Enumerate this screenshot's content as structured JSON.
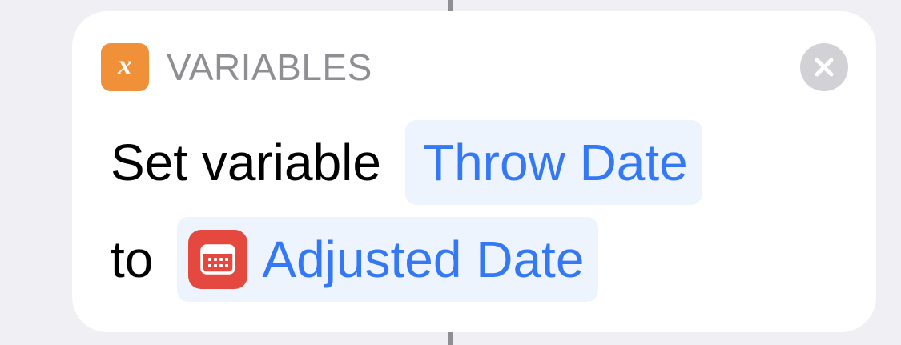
{
  "action": {
    "category_label": "VARIABLES",
    "category_icon": "x-variable-icon",
    "category_icon_glyph": "x",
    "close_icon": "close-circle-icon",
    "line1_text": "Set variable",
    "variable_name": "Throw Date",
    "line2_text": "to",
    "value_name": "Adjusted Date",
    "value_icon": "calendar-icon"
  },
  "colors": {
    "category_accent": "#f0913a",
    "token_text": "#3478f6",
    "token_background": "#edf4fd",
    "calendar_icon": "#e5483f",
    "close_button": "#d1d1d6"
  }
}
